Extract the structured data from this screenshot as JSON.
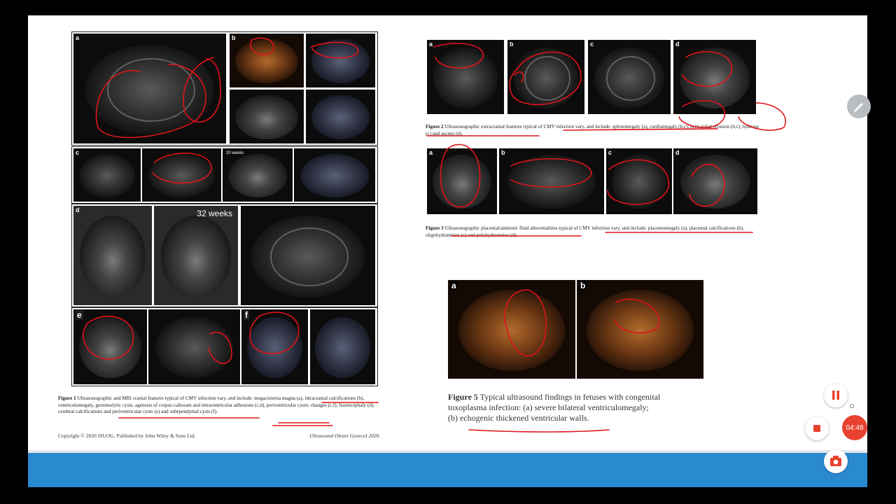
{
  "figure1": {
    "labels": [
      "a",
      "b",
      "c",
      "d",
      "e",
      "f"
    ],
    "weeks_label": "32 weeks",
    "weeks_small": "20 weeks",
    "caption_title": "Figure 1",
    "caption_text": "Ultrasonographic and MRI cranial features typical of CMV infection vary, and include: megacisterna magna (a), intracranial calcifications (b), ventriculomegaly, germinolytic cysts, agenesis of corpus callosum and intraventricular adhesions (c,d), periventricular cystic changes (c,f), lissencephaly (d), cerebral calcifications and periventricular cysts (e) and subependymal cysts (f)."
  },
  "footer": {
    "copyright": "Copyright © 2020 ISUOG. Published by John Wiley & Sons Ltd.",
    "journal": "Ultrasound Obstet Gynecol 2020."
  },
  "figure2": {
    "labels": [
      "a",
      "b",
      "c",
      "d"
    ],
    "caption_title": "Figure 2",
    "caption_text": "Ultrasonographic extracranial features typical of CMV infection vary, and include: splenomegaly (a), cardiomegaly (b,c), pericardial effusion (b,c), hydrops (c) and ascites (d)."
  },
  "figure3": {
    "labels": [
      "a",
      "b",
      "c",
      "d"
    ],
    "caption_title": "Figure 3",
    "caption_text": "Ultrasonographic placental/amniotic fluid abnormalities typical of CMV infection vary, and include: placentomegaly (a), placental calcifications (b), oligohydramnios (c) and polyhydramnios (d)."
  },
  "figure5": {
    "labels": [
      "a",
      "b"
    ],
    "caption_title": "Figure 5",
    "caption_line1": "Typical ultrasound findings in fetuses with congenital",
    "caption_line2": "toxoplasma infection: (a) severe bilateral ventriculomegaly;",
    "caption_line3": "(b) echogenic thickened ventricular walls."
  },
  "recorder": {
    "timer": "04:48",
    "icons": [
      "pencil-icon",
      "pause-icon",
      "stop-icon",
      "camera-icon"
    ],
    "accent_color": "#e9412f"
  },
  "colors": {
    "annotation": "#e0141a",
    "bottom_bar": "#2a8ad0"
  }
}
